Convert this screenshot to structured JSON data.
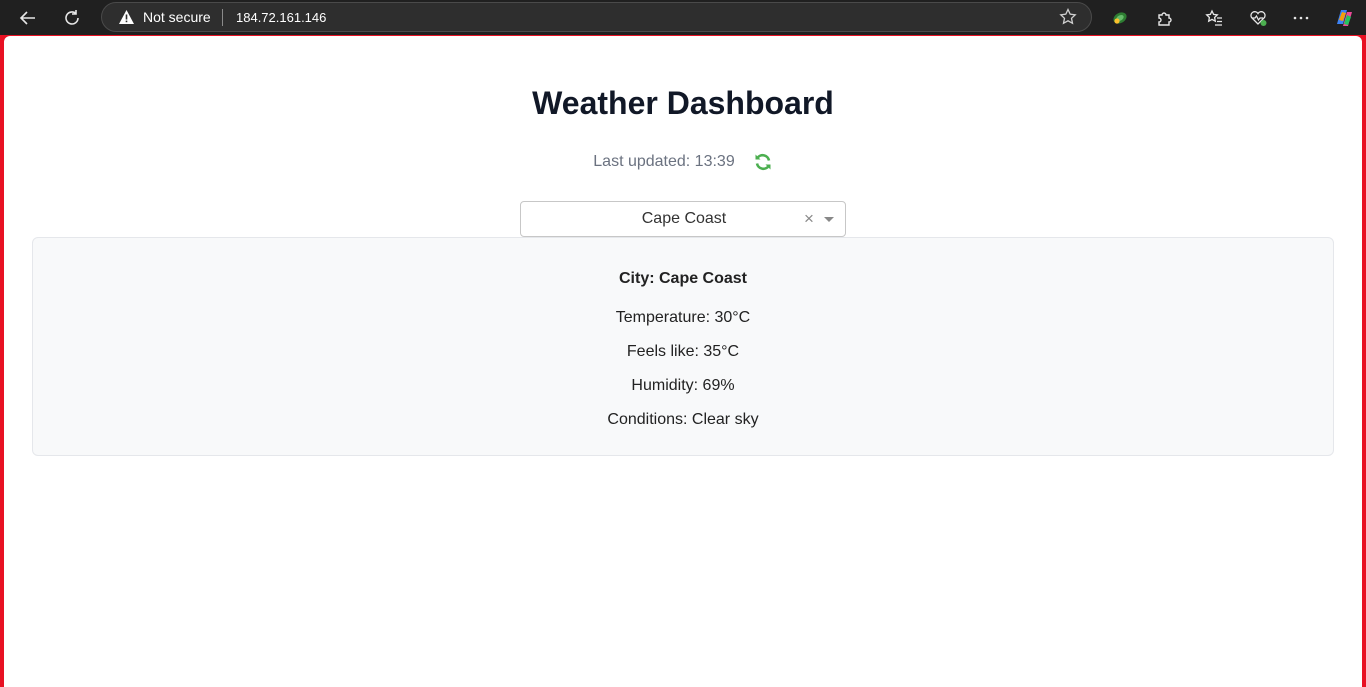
{
  "browser": {
    "security_label": "Not secure",
    "url": "184.72.161.146",
    "icons": [
      "back-icon",
      "reload-icon",
      "warning-icon",
      "favorite-star-icon",
      "extension-icon",
      "puzzle-icon",
      "favorites-icon",
      "health-icon",
      "more-icon",
      "copilot-icon"
    ]
  },
  "page": {
    "title": "Weather Dashboard",
    "last_updated": "Last updated: 13:39",
    "refresh_icon_color": "#4caf50"
  },
  "city_select": {
    "value": "Cape Coast",
    "clear_glyph": "×"
  },
  "weather": {
    "city": "City: Cape Coast",
    "temperature": "Temperature: 30°C",
    "feels_like": "Feels like: 35°C",
    "humidity": "Humidity: 69%",
    "conditions": "Conditions: Clear sky"
  }
}
